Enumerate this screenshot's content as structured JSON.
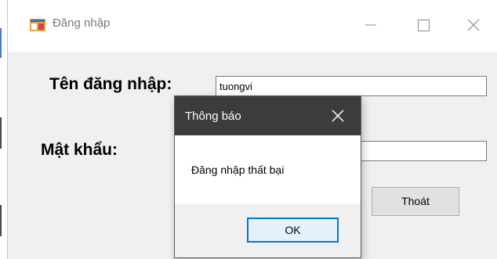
{
  "window": {
    "title": "Đăng nhập",
    "minimize_icon": "minimize-icon",
    "maximize_icon": "maximize-icon",
    "close_icon": "close-icon"
  },
  "form": {
    "username_label": "Tên đăng nhập:",
    "username_value": "tuongvi",
    "password_label": "Mật khẩu:",
    "password_value": "",
    "exit_button": "Thoát"
  },
  "dialog": {
    "title": "Thông báo",
    "message": "Đăng nhập thất bại",
    "ok_button": "OK",
    "close_icon": "close-icon"
  },
  "colors": {
    "dialog_title_bg": "#3c3c3c",
    "ok_button_border": "#0078d7",
    "window_bg": "#f0f0f0"
  }
}
